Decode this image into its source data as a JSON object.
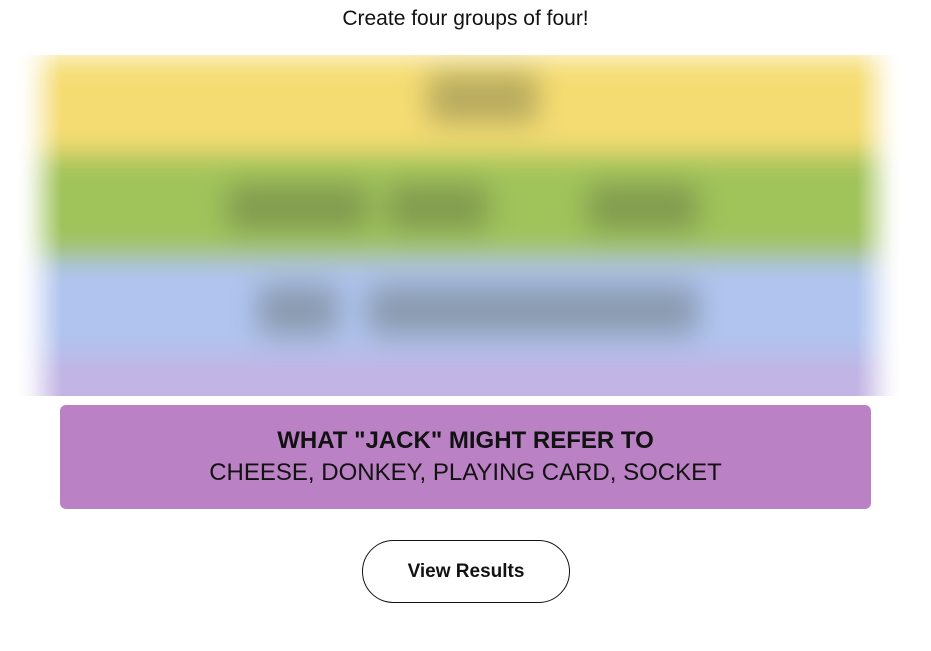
{
  "instructions": "Create four groups of four!",
  "board": {
    "state": "blurred",
    "band_colors": [
      "#f5dc72",
      "#a0c35a",
      "#b0c4ef",
      "#c2b4e4"
    ]
  },
  "solved_group": {
    "title": "WHAT \"JACK\" MIGHT REFER TO",
    "members": "CHEESE, DONKEY, PLAYING CARD, SOCKET",
    "color": "#ba81c5"
  },
  "actions": {
    "view_results_label": "View Results"
  }
}
